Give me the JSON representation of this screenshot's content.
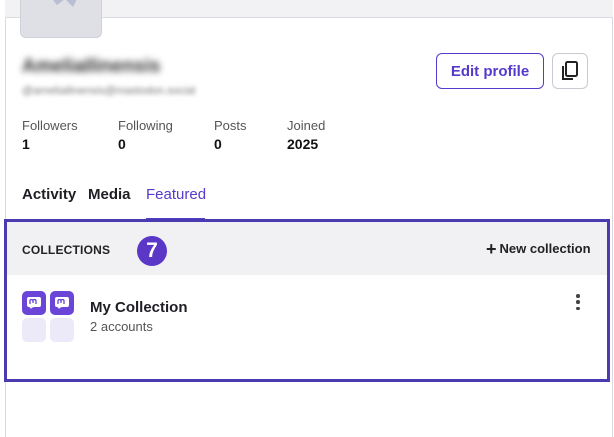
{
  "profile": {
    "display_name": "AmeliaIlinensis",
    "handle": "@ameliailinensis@mastodon.social",
    "edit_label": "Edit profile",
    "copy_icon": "copy-icon"
  },
  "stats": [
    {
      "label": "Followers",
      "value": "1"
    },
    {
      "label": "Following",
      "value": "0"
    },
    {
      "label": "Posts",
      "value": "0"
    },
    {
      "label": "Joined",
      "value": "2025"
    }
  ],
  "tabs": [
    {
      "label": "Activity",
      "active": false
    },
    {
      "label": "Media",
      "active": false
    },
    {
      "label": "Featured",
      "active": true
    }
  ],
  "collections": {
    "title": "COLLECTIONS",
    "step_badge": "7",
    "new_label": "New collection",
    "items": [
      {
        "name": "My Collection",
        "count": "2 accounts",
        "icon": "mastodon-icon"
      }
    ]
  },
  "colors": {
    "accent": "#563acc",
    "frame": "#4a3cb0",
    "badge": "#5b37c8"
  }
}
